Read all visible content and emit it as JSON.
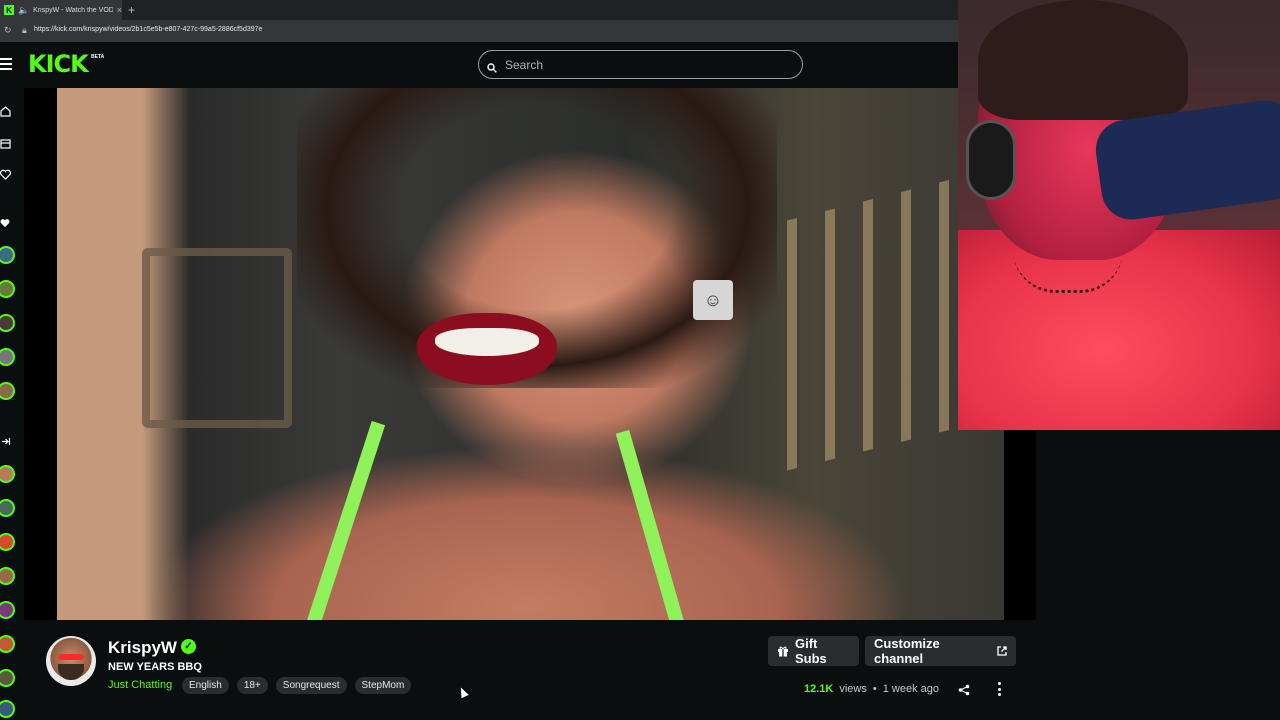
{
  "browser": {
    "tab_title": "KrispyW - Watch the VOD on",
    "tab_favicon": "K",
    "url": "https://kick.com/krispyw/videos/2b1c5e5b-e807-427c-99a5-2886cf5d397e"
  },
  "header": {
    "logo": "KICK",
    "logo_badge": "BETA",
    "search_placeholder": "Search"
  },
  "channel": {
    "name": "KrispyW",
    "title": "NEW YEARS BBQ",
    "category": "Just Chatting",
    "tags": [
      "English",
      "18+",
      "Songrequest",
      "StepMom"
    ],
    "verified": true
  },
  "actions": {
    "gift_label": "Gift Subs",
    "customize_label": "Customize channel"
  },
  "stats": {
    "views_count": "12.1K",
    "views_label": "views",
    "separator": "•",
    "posted": "1 week ago"
  },
  "colors": {
    "accent": "#53fc18",
    "background": "#0b0e0f",
    "button_bg": "#2a2d30"
  },
  "icons": [
    "hamburger-icon",
    "search-icon",
    "home-icon",
    "browse-icon",
    "following-icon",
    "heart-icon",
    "verified-icon",
    "gift-icon",
    "external-link-icon",
    "share-icon",
    "more-vertical-icon"
  ]
}
